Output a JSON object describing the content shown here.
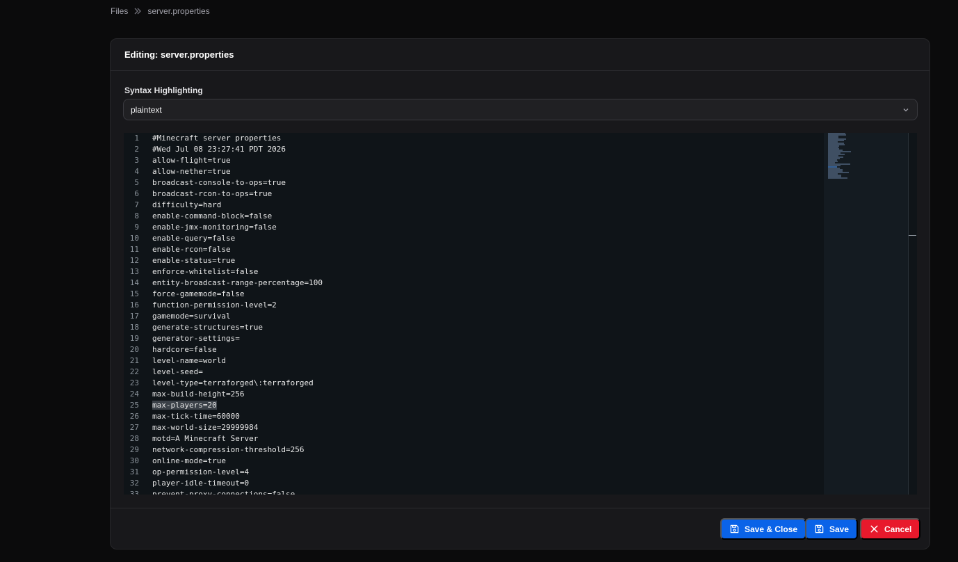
{
  "breadcrumb": {
    "root": "Files",
    "current": "server.properties"
  },
  "card": {
    "title": "Editing: server.properties"
  },
  "syntax": {
    "label": "Syntax Highlighting",
    "value": "plaintext"
  },
  "editor": {
    "selected_line": 25,
    "lines": [
      "#Minecraft server properties",
      "#Wed Jul 08 23:27:41 PDT 2026",
      "allow-flight=true",
      "allow-nether=true",
      "broadcast-console-to-ops=true",
      "broadcast-rcon-to-ops=true",
      "difficulty=hard",
      "enable-command-block=false",
      "enable-jmx-monitoring=false",
      "enable-query=false",
      "enable-rcon=false",
      "enable-status=true",
      "enforce-whitelist=false",
      "entity-broadcast-range-percentage=100",
      "force-gamemode=false",
      "function-permission-level=2",
      "gamemode=survival",
      "generate-structures=true",
      "generator-settings=",
      "hardcore=false",
      "level-name=world",
      "level-seed=",
      "level-type=terraforged\\:terraforged",
      "max-build-height=256",
      "max-players=20",
      "max-tick-time=60000",
      "max-world-size=29999984",
      "motd=A Minecraft Server",
      "network-compression-threshold=256",
      "online-mode=true",
      "op-permission-level=4",
      "player-idle-timeout=0",
      "prevent-proxy-connections=false"
    ]
  },
  "buttons": {
    "save_close": "Save & Close",
    "save": "Save",
    "cancel": "Cancel"
  },
  "colors": {
    "primary": "#0a63e8",
    "danger": "#e8192c",
    "background": "#0b0b0c",
    "card": "#18181b"
  }
}
